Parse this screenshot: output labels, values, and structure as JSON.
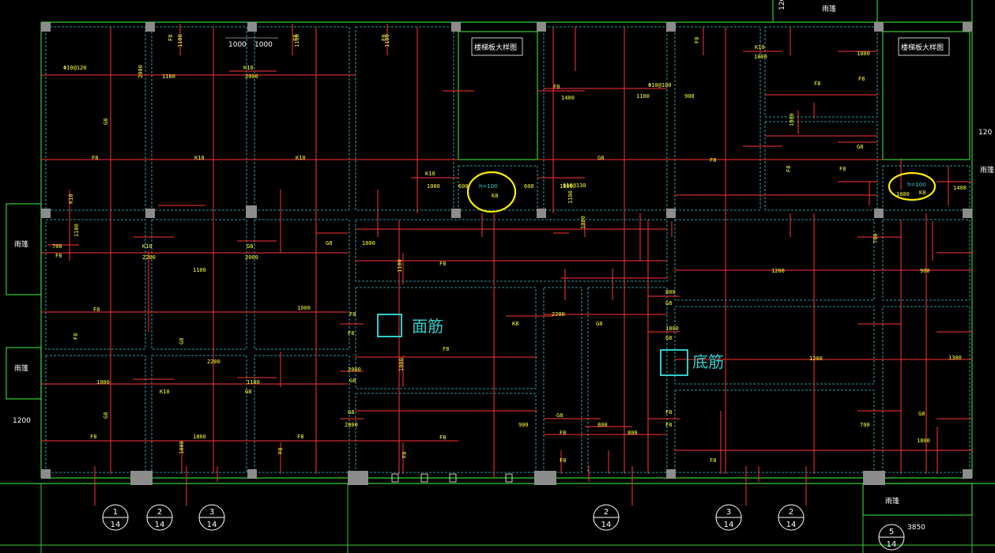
{
  "drawing": {
    "legend": {
      "top_bar": "面筋",
      "bottom_bar": "底筋"
    },
    "canopy_label": "雨篷",
    "stair_label": "楼梯板大样图",
    "axis_circles": [
      {
        "num": "1",
        "den": "14"
      },
      {
        "num": "2",
        "den": "14"
      },
      {
        "num": "3",
        "den": "14"
      },
      {
        "num": "2",
        "den": "14"
      },
      {
        "num": "3",
        "den": "14"
      },
      {
        "num": "2",
        "den": "14"
      },
      {
        "num": "5",
        "den": "14"
      }
    ],
    "dimensions": [
      "1000",
      "1000",
      "1200",
      "120",
      "120",
      "3850"
    ],
    "hole_labels": [
      {
        "h": "h=100",
        "k": "K8"
      },
      {
        "h": "h=100",
        "k": "K8"
      }
    ],
    "rebar_labels": [
      "Φ10@120",
      "1180",
      "K10",
      "2000",
      "G8",
      "2000",
      "F8",
      "1100",
      "F8",
      "1100",
      "F8",
      "1100",
      "F8",
      "1400",
      "Φ10@100",
      "1100",
      "900",
      "F8",
      "1800",
      "K10",
      "1800",
      "F8",
      "1000",
      "G8",
      "F8",
      "F8",
      "K10",
      "K10",
      "G8",
      "F8",
      "F8",
      "F8",
      "K10",
      "600",
      "600",
      "1300",
      "1000",
      "K10",
      "1100",
      "K10",
      "2200",
      "G8",
      "2000",
      "G8",
      "1000",
      "700",
      "F8",
      "1100",
      "F8",
      "1000",
      "F8",
      "F8",
      "F8",
      "F8",
      "G8",
      "2200",
      "1000",
      "K10",
      "1100",
      "G8",
      "2000",
      "G8",
      "2200",
      "G8",
      "800",
      "G8",
      "1800",
      "G8",
      "1800",
      "F8",
      "F8",
      "F8",
      "F8",
      "G8",
      "2000",
      "F8",
      "1000",
      "800",
      "900",
      "G8",
      "G8",
      "800",
      "G8",
      "1800",
      "F8",
      "F8",
      "1200",
      "1200",
      "1000",
      "F8",
      "F8",
      "F8",
      "F8",
      "900",
      "1300",
      "700",
      "Φ10@130",
      "1000",
      "1100",
      "1100",
      "K8",
      "700",
      "1000",
      "1400"
    ]
  }
}
